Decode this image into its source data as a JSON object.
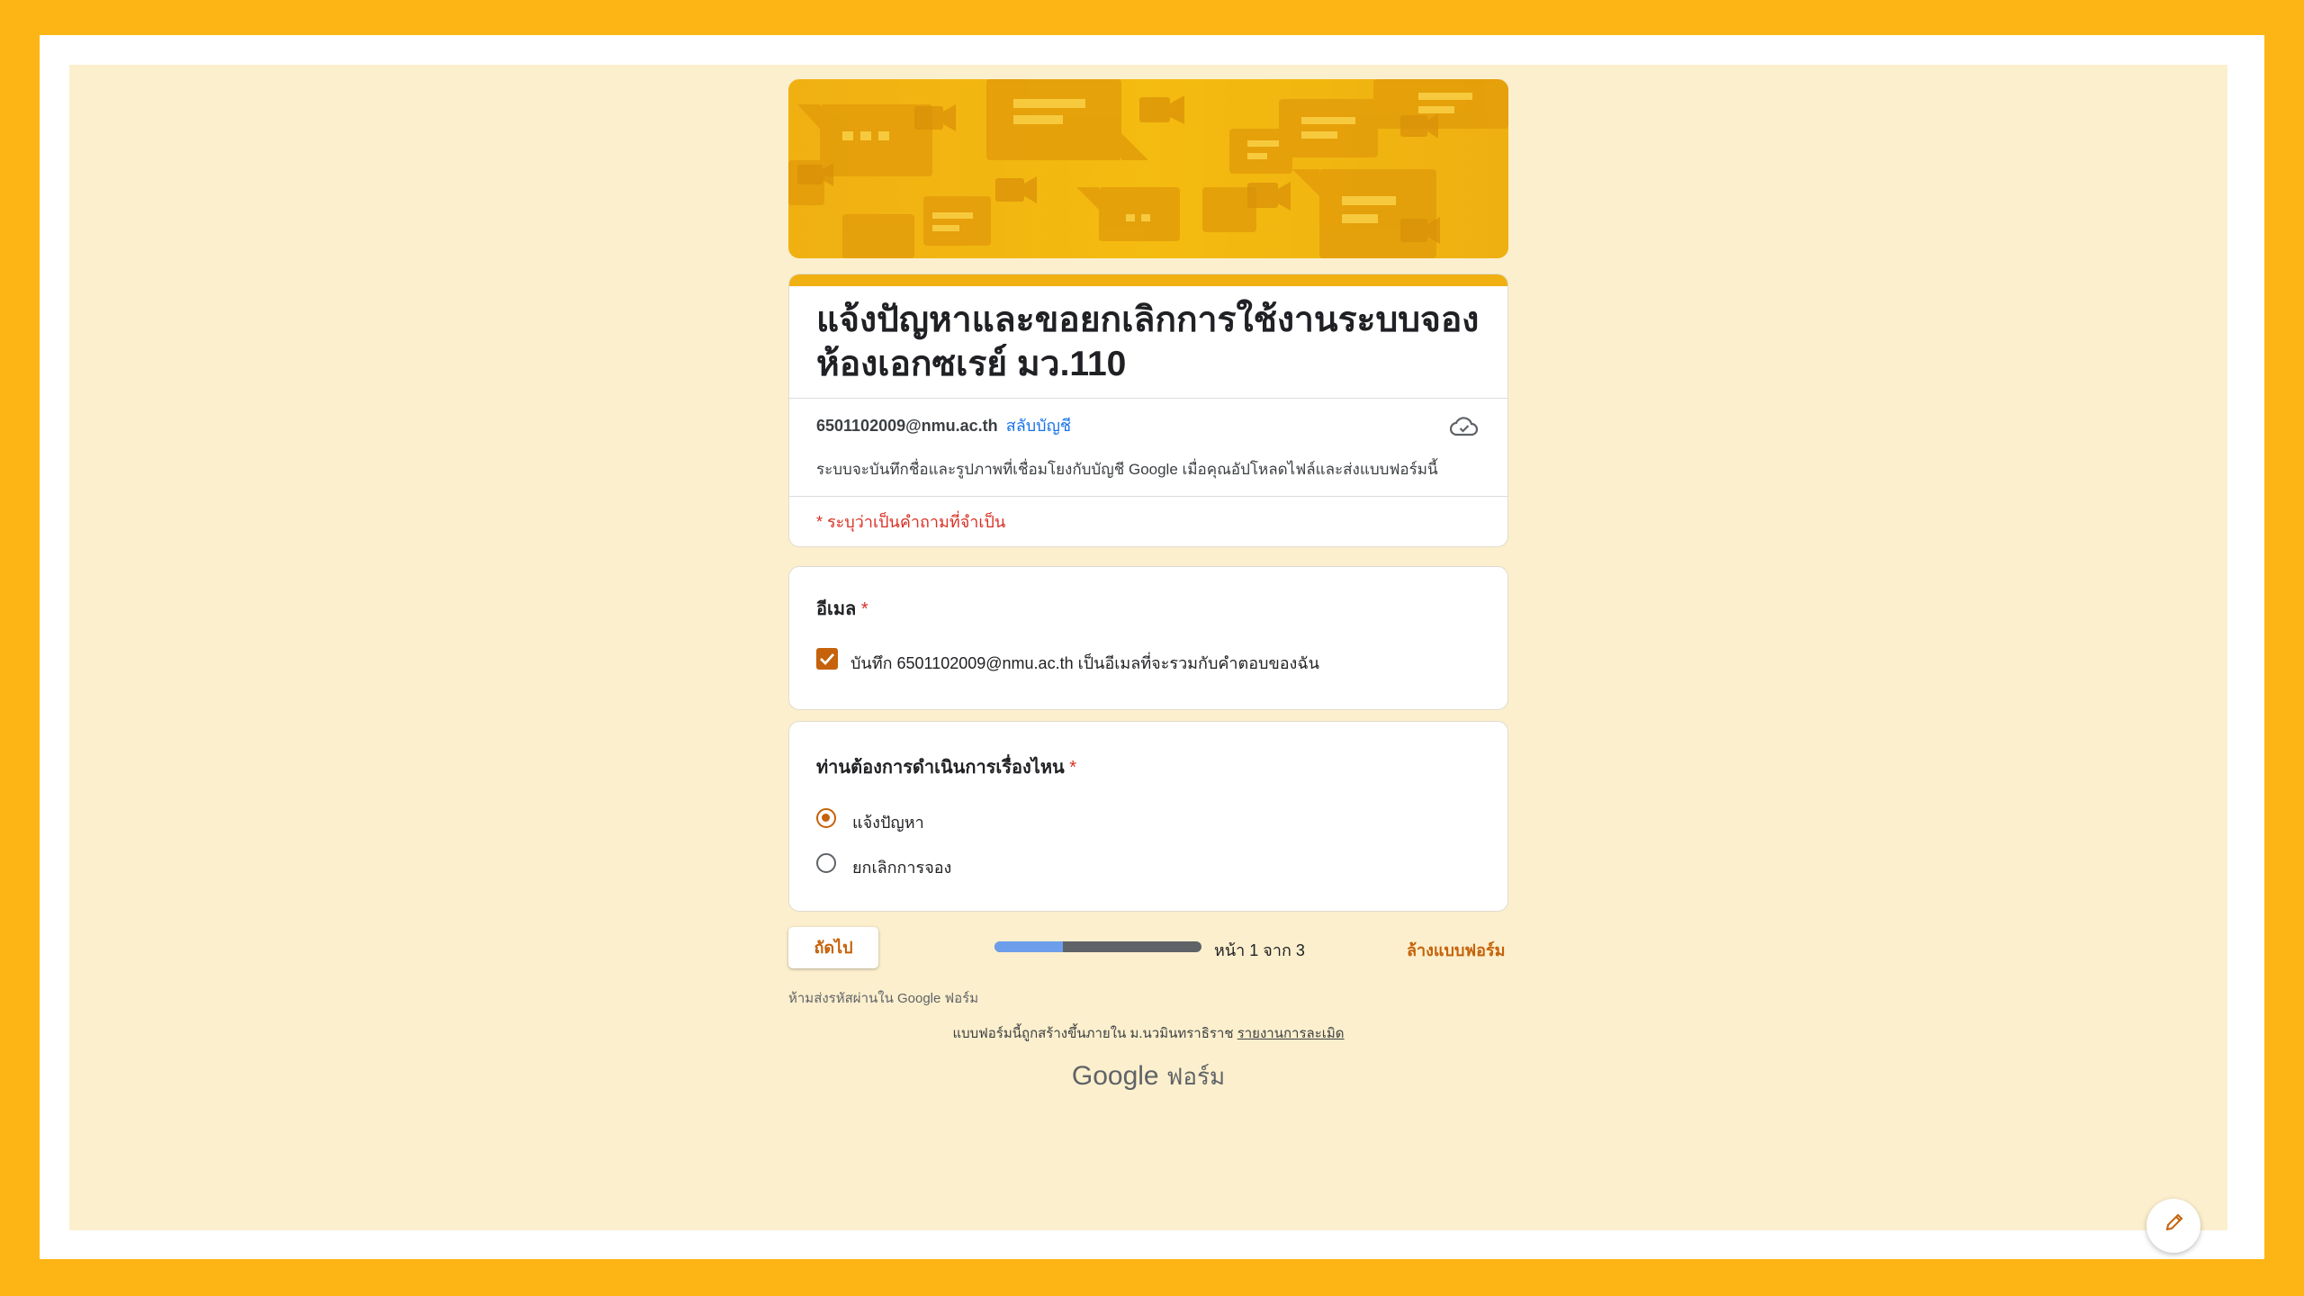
{
  "form": {
    "title": "แจ้งปัญหาและขอยกเลิกการใช้งานระบบจองห้องเอกซเรย์ มว.110",
    "account_email": "6501102009@nmu.ac.th",
    "switch_account": "สลับบัญชี",
    "save_notice": "ระบบจะบันทึกชื่อและรูปภาพที่เชื่อมโยงกับบัญชี Google เมื่อคุณอัปโหลดไฟล์และส่งแบบฟอร์มนี้",
    "required_note": "* ระบุว่าเป็นคำถามที่จำเป็น"
  },
  "email_question": {
    "label": "อีเมล",
    "required_mark": "*",
    "checkbox_label": "บันทึก 6501102009@nmu.ac.th เป็นอีเมลที่จะรวมกับคำตอบของฉัน",
    "checked": true
  },
  "choice_question": {
    "label": "ท่านต้องการดำเนินการเรื่องไหน",
    "required_mark": "*",
    "options": [
      {
        "label": "แจ้งปัญหา",
        "selected": true
      },
      {
        "label": "ยกเลิกการจอง",
        "selected": false
      }
    ]
  },
  "navigation": {
    "next_button": "ถัดไป",
    "progress": 0.33,
    "page_count": "หน้า 1 จาก 3",
    "clear_form": "ล้างแบบฟอร์ม"
  },
  "footer": {
    "never_submit": "ห้ามส่งรหัสผ่านใน Google ฟอร์ม",
    "created_text": "แบบฟอร์มนี้ถูกสร้างขึ้นภายใน ม.นวมินทราธิราช",
    "report_link": "รายงานการละเมิด",
    "logo_google": "Google",
    "logo_forms": "ฟอร์ม"
  },
  "colors": {
    "outer_frame": "#fdb515",
    "page_background": "#fcefcd",
    "accent": "#c5620b",
    "banner": "#f4bb10",
    "required": "#d93025",
    "link": "#1a73e8",
    "progress_fill": "#6d9eeb"
  },
  "icons": {
    "cloud": "cloud-check-icon",
    "checkbox": "checkmark-icon",
    "fab": "pencil-icon"
  }
}
